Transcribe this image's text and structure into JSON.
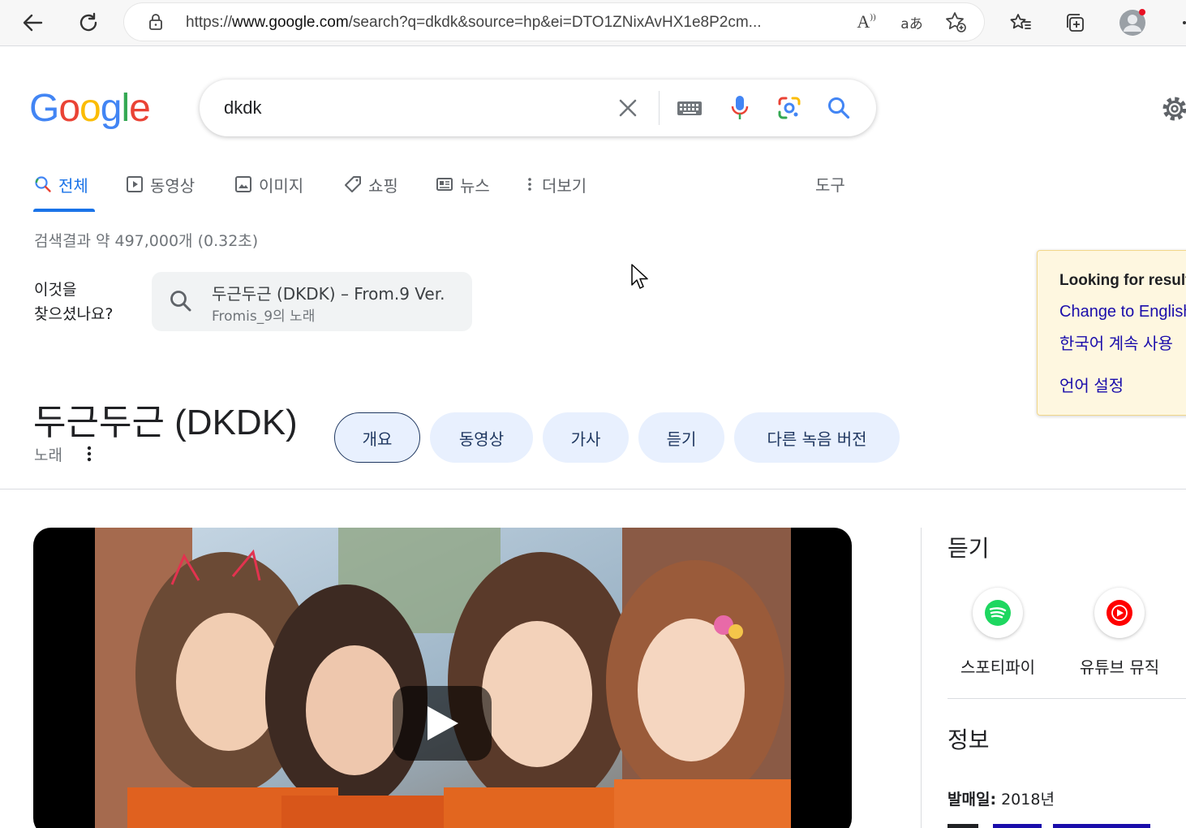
{
  "browser": {
    "url_prefix": "https://",
    "url_host": "www.google.com",
    "url_rest": "/search?q=dkdk&source=hp&ei=DTO1ZNixAvHX1e8P2cm...",
    "read_aloud_label": "A",
    "translate_label": "aあ"
  },
  "search": {
    "query": "dkdk"
  },
  "logo": {
    "letters": [
      "G",
      "o",
      "o",
      "g",
      "l",
      "e"
    ],
    "colors": [
      "#4285f4",
      "#ea4335",
      "#fbbc05",
      "#4285f4",
      "#34a853",
      "#ea4335"
    ]
  },
  "tabs": [
    {
      "label": "전체",
      "icon": "search-icon"
    },
    {
      "label": "동영상",
      "icon": "play-square-icon"
    },
    {
      "label": "이미지",
      "icon": "image-icon"
    },
    {
      "label": "쇼핑",
      "icon": "tag-icon"
    },
    {
      "label": "뉴스",
      "icon": "news-icon"
    },
    {
      "label": "더보기",
      "icon": "more-vert-icon"
    }
  ],
  "tools_label": "도구",
  "result_stats": "검색결과 약 497,000개 (0.32초)",
  "did_you_mean": {
    "label_line1": "이것을",
    "label_line2": "찾으셨나요?",
    "title": "두근두근 (DKDK) – From.9 Ver.",
    "subtitle": "Fromis_9의 노래"
  },
  "language_notice": {
    "title": "Looking for results in English?",
    "change_link": "Change to English",
    "keep_link": "한국어 계속 사용",
    "settings_link": "언어 설정"
  },
  "knowledge": {
    "title": "두근두근 (DKDK)",
    "subtitle": "노래",
    "chips": [
      "개요",
      "동영상",
      "가사",
      "듣기",
      "다른 녹음 버전"
    ]
  },
  "right_panel": {
    "listen_heading": "듣기",
    "services": [
      {
        "label": "스포티파이",
        "icon": "spotify-icon",
        "color": "#1ed760"
      },
      {
        "label": "유튜브 뮤직",
        "icon": "youtube-music-icon",
        "color": "#ff0000"
      }
    ],
    "info_heading": "정보",
    "release_label": "발매일:",
    "release_value": "2018년"
  },
  "colors": {
    "accent": "#1a73e8",
    "chip_bg": "#e8f0fe",
    "link": "#1a0dab",
    "notice_bg": "#fef7e0"
  }
}
